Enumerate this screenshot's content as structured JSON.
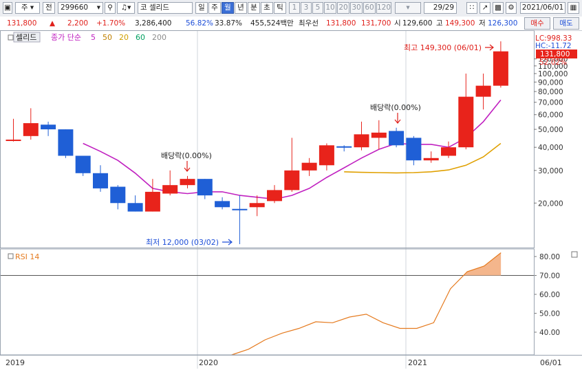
{
  "toolbar": {
    "market": "주",
    "code_type": "전",
    "stock_code": "299660",
    "stock_name": "셀리드",
    "exchange_badge": "코",
    "periods": [
      "일",
      "주",
      "월",
      "년",
      "분",
      "초",
      "틱"
    ],
    "active_period": "월",
    "intervals": [
      "1",
      "3",
      "5",
      "10",
      "20",
      "30",
      "60",
      "120"
    ],
    "page_counter": "29/29",
    "date": "2021/06/01"
  },
  "quote": {
    "price": "131,800",
    "change": "2,200",
    "change_pct": "+1.70%",
    "volume": "3,286,400",
    "ratio1": "56.82%",
    "ratio2": "33.87%",
    "trade_value": "455,524백만",
    "best_ask_label": "최우선",
    "best_ask": "131,800",
    "best_bid": "131,700",
    "open_label": "시",
    "open": "129,600",
    "high_label": "고",
    "high": "149,300",
    "low_label": "저",
    "low": "126,300",
    "buy_label": "매수",
    "sell_label": "매도"
  },
  "legend": {
    "name": "셀리드",
    "ma_label": "종가 단순",
    "ma_periods": [
      "5",
      "50",
      "20",
      "60",
      "200"
    ],
    "ma_colors": [
      "#c020c0",
      "#c08000",
      "#d0a000",
      "#00a060",
      "#8c8c8c"
    ]
  },
  "right_labels": {
    "lc": "LC:998.33",
    "hc": "HC:-11.72",
    "last_price": "131,800",
    "last_pct": "52.02%"
  },
  "annotations": {
    "high_note": "최고 149,300 (06/01)",
    "low_note": "최저 12,000 (03/02)",
    "dividend1": "배당락(0.00%)",
    "dividend2": "배당락(0.00%)"
  },
  "rsi_label": "RSI 14",
  "x_labels": [
    "2019",
    "2020",
    "2021",
    "06/01"
  ],
  "chart_data": {
    "type": "candlestick",
    "y_scale": "log",
    "price_ticks": [
      20000,
      30000,
      40000,
      50000,
      60000,
      70000,
      80000,
      90000,
      100000,
      110000,
      120000
    ],
    "price_tick_labels": [
      "20,000",
      "30,000",
      "40,000",
      "50,000",
      "60,000",
      "70,000",
      "80,000",
      "90,000",
      "100,000",
      "110,000",
      "120,000"
    ],
    "candles": [
      {
        "o": 44000,
        "h": 57000,
        "l": 43000,
        "c": 44000,
        "up": true
      },
      {
        "o": 46000,
        "h": 65000,
        "l": 44000,
        "c": 54000,
        "up": true
      },
      {
        "o": 53000,
        "h": 55000,
        "l": 46000,
        "c": 50000,
        "up": false
      },
      {
        "o": 50000,
        "h": 50000,
        "l": 35000,
        "c": 36000,
        "up": false
      },
      {
        "o": 36000,
        "h": 36000,
        "l": 28000,
        "c": 29000,
        "up": false
      },
      {
        "o": 29000,
        "h": 32000,
        "l": 23000,
        "c": 24000,
        "up": false
      },
      {
        "o": 24500,
        "h": 25000,
        "l": 18500,
        "c": 20000,
        "up": false
      },
      {
        "o": 20000,
        "h": 22000,
        "l": 18000,
        "c": 18000,
        "up": false
      },
      {
        "o": 18000,
        "h": 27000,
        "l": 18000,
        "c": 23000,
        "up": true
      },
      {
        "o": 22500,
        "h": 30000,
        "l": 22000,
        "c": 25000,
        "up": true
      },
      {
        "o": 25000,
        "h": 28000,
        "l": 24000,
        "c": 27000,
        "up": true
      },
      {
        "o": 27000,
        "h": 27000,
        "l": 21000,
        "c": 22000,
        "up": false
      },
      {
        "o": 20500,
        "h": 21500,
        "l": 18500,
        "c": 19000,
        "up": false
      },
      {
        "o": 18600,
        "h": 22000,
        "l": 12000,
        "c": 18500,
        "up": false
      },
      {
        "o": 19000,
        "h": 22000,
        "l": 17000,
        "c": 20000,
        "up": true
      },
      {
        "o": 20500,
        "h": 25000,
        "l": 20000,
        "c": 23500,
        "up": true
      },
      {
        "o": 23500,
        "h": 45000,
        "l": 23000,
        "c": 30000,
        "up": true
      },
      {
        "o": 30000,
        "h": 35000,
        "l": 28000,
        "c": 33000,
        "up": true
      },
      {
        "o": 32000,
        "h": 42000,
        "l": 30000,
        "c": 41000,
        "up": true
      },
      {
        "o": 40000,
        "h": 41000,
        "l": 38000,
        "c": 40500,
        "up": false
      },
      {
        "o": 40000,
        "h": 55000,
        "l": 38500,
        "c": 47000,
        "up": true
      },
      {
        "o": 45000,
        "h": 56000,
        "l": 39000,
        "c": 48000,
        "up": true
      },
      {
        "o": 49000,
        "h": 51000,
        "l": 40000,
        "c": 41000,
        "up": false
      },
      {
        "o": 45000,
        "h": 46000,
        "l": 32000,
        "c": 34000,
        "up": false
      },
      {
        "o": 34000,
        "h": 38000,
        "l": 33000,
        "c": 35000,
        "up": true
      },
      {
        "o": 36000,
        "h": 43000,
        "l": 35000,
        "c": 40000,
        "up": true
      },
      {
        "o": 40000,
        "h": 100000,
        "l": 39000,
        "c": 75000,
        "up": true
      },
      {
        "o": 75000,
        "h": 100000,
        "l": 64000,
        "c": 86000,
        "up": true
      },
      {
        "o": 86000,
        "h": 149300,
        "l": 84000,
        "c": 131800,
        "up": true
      }
    ],
    "ma5": [
      null,
      null,
      null,
      null,
      42000,
      38000,
      34000,
      29000,
      24000,
      23000,
      22500,
      23000,
      23000,
      22000,
      21500,
      21000,
      22000,
      24000,
      27500,
      31000,
      35000,
      39000,
      42000,
      41500,
      41500,
      40000,
      45000,
      55000,
      72000
    ],
    "ma20": [
      null,
      null,
      null,
      null,
      null,
      null,
      null,
      null,
      null,
      null,
      null,
      null,
      null,
      null,
      null,
      null,
      null,
      null,
      null,
      29500,
      29300,
      29200,
      29100,
      29200,
      29500,
      30200,
      32000,
      35500,
      42000
    ],
    "rsi_ticks": [
      40,
      50,
      60,
      70,
      80
    ],
    "rsi_tick_labels": [
      "40.00",
      "50.00",
      "60.00",
      "70.00",
      "80.00"
    ],
    "rsi_threshold": 70,
    "rsi": [
      null,
      null,
      null,
      null,
      null,
      null,
      null,
      null,
      null,
      null,
      null,
      null,
      null,
      null,
      28,
      31,
      36,
      39.5,
      42,
      45.5,
      45,
      48,
      49.5,
      45,
      42,
      42,
      45,
      63,
      72,
      75,
      82
    ]
  }
}
